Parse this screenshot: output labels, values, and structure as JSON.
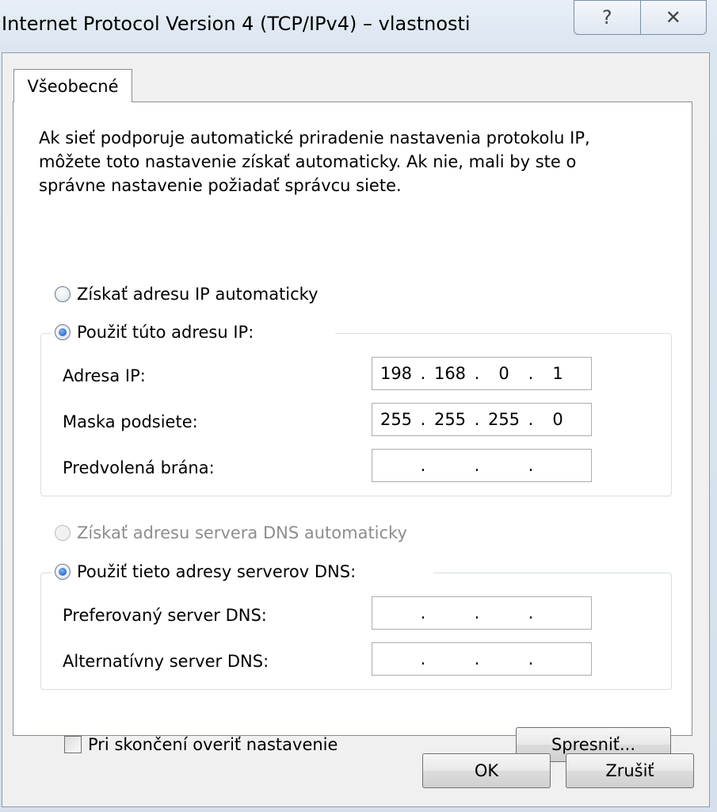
{
  "window": {
    "title": "Internet Protocol Version 4 (TCP/IPv4) – vlastnosti",
    "help_glyph": "?",
    "close_glyph": "✕"
  },
  "tab": {
    "label": "Všeobecné"
  },
  "description": [
    "Ak sieť podporuje automatické priradenie nastavenia protokolu IP,",
    "môžete toto nastavenie získať automaticky. Ak nie, mali by ste o",
    "správne nastavenie požiadať správcu siete."
  ],
  "ip_section": {
    "auto_radio_label": "Získať adresu IP automaticky",
    "manual_radio_label": "Použiť túto adresu IP:",
    "selected": "manual",
    "fields": [
      {
        "label": "Adresa IP:",
        "octets": [
          "198",
          "168",
          "0",
          "1"
        ]
      },
      {
        "label": "Maska podsiete:",
        "octets": [
          "255",
          "255",
          "255",
          "0"
        ]
      },
      {
        "label": "Predvolená brána:",
        "octets": [
          "",
          "",
          "",
          ""
        ]
      }
    ]
  },
  "dns_section": {
    "auto_radio_label": "Získať adresu servera DNS automaticky",
    "manual_radio_label": "Použiť tieto adresy serverov DNS:",
    "selected": "manual",
    "fields": [
      {
        "label": "Preferovaný server DNS:",
        "octets": [
          "",
          "",
          "",
          ""
        ]
      },
      {
        "label": "Alternatívny server DNS:",
        "octets": [
          "",
          "",
          "",
          ""
        ]
      }
    ]
  },
  "validate_checkbox": {
    "label": "Pri skončení overiť nastavenie",
    "checked": false
  },
  "buttons": {
    "advanced": "Spresniť...",
    "ok": "OK",
    "cancel": "Zrušiť"
  }
}
